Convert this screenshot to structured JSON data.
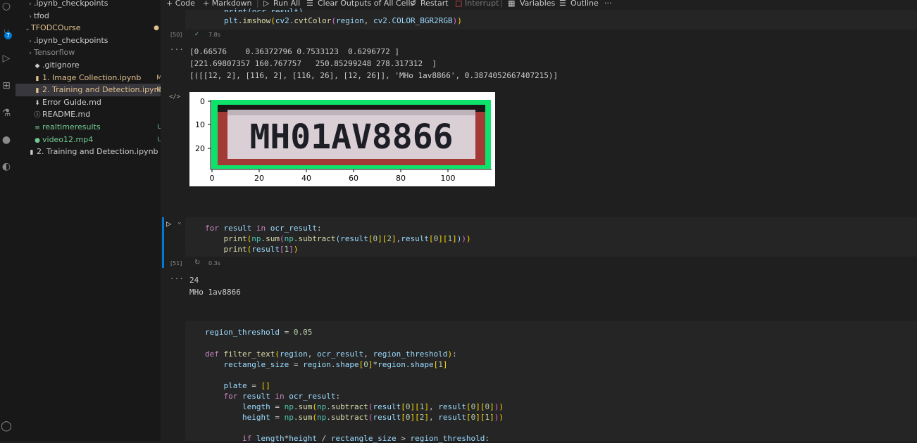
{
  "activity_bar": {
    "extensions_badge": "7"
  },
  "explorer": {
    "items": [
      {
        "chevron": ">",
        "icon": "",
        "label": ".ipynb_checkpoints",
        "deco": "",
        "color": "#cccccc"
      },
      {
        "chevron": ">",
        "icon": "",
        "label": "tfod",
        "deco": "",
        "color": "#cccccc"
      },
      {
        "chevron": "v",
        "icon": "",
        "label": "TFODCOurse",
        "deco": "●",
        "color": "#e2c08d"
      },
      {
        "chevron": ">",
        "icon": "",
        "label": ".ipynb_checkpoints",
        "deco": "",
        "color": "#cccccc"
      },
      {
        "chevron": ">",
        "icon": "",
        "label": "Tensorflow",
        "deco": "",
        "color": "#8c8c8c"
      },
      {
        "chevron": "",
        "icon": "◆",
        "label": ".gitignore",
        "deco": "",
        "color": "#cccccc"
      },
      {
        "chevron": "",
        "icon": "▮",
        "label": "1. Image Collection.ipynb",
        "deco": "M",
        "color": "#e2c08d"
      },
      {
        "chevron": "",
        "icon": "▮",
        "label": "2. Training and Detection.ipynb",
        "deco": "M",
        "color": "#e2c08d"
      },
      {
        "chevron": "",
        "icon": "⬇",
        "label": "Error Guide.md",
        "deco": "",
        "color": "#cccccc"
      },
      {
        "chevron": "",
        "icon": "ⓘ",
        "label": "README.md",
        "deco": "",
        "color": "#cccccc"
      },
      {
        "chevron": "",
        "icon": "≡",
        "label": "realtimeresults",
        "deco": "U",
        "color": "#73c991"
      },
      {
        "chevron": "",
        "icon": "●",
        "label": "video12.mp4",
        "deco": "U",
        "color": "#73c991"
      },
      {
        "chevron": "",
        "icon": "▮",
        "label": "2. Training and Detection.ipynb",
        "deco": "",
        "color": "#cccccc"
      }
    ]
  },
  "toolbar": {
    "code": "+ Code",
    "markdown": "+ Markdown",
    "run_all": "Run All",
    "clear_outputs": "Clear Outputs of All Cells",
    "restart": "Restart",
    "interrupt": "Interrupt",
    "variables": "Variables",
    "outline": "Outline",
    "more": "···"
  },
  "cell50": {
    "partial_line": "print(ocr_result)",
    "line": "plt.imshow(cv2.cvtColor(region, cv2.COLOR_BGR2RGB))",
    "exec_count": "[50]",
    "duration": "7.8s",
    "output_lines": [
      "[0.66576    0.36372796 0.7533123  0.6296772 ]",
      "[221.69807357 160.767757   250.85299248 278.317312  ]",
      "[([[12, 2], [116, 2], [116, 26], [12, 26]], 'MHo 1av8866', 0.3874052667407215)]"
    ],
    "plot": {
      "plate_text": "MH01AV8866",
      "xticks": [
        "0",
        "20",
        "40",
        "60",
        "80",
        "100"
      ],
      "yticks": [
        "0",
        "10",
        "20"
      ]
    }
  },
  "cell51": {
    "exec_count": "[51]",
    "duration": "0.3s",
    "output_lines": [
      "24",
      "MHo 1av8866"
    ]
  },
  "cell52": {}
}
